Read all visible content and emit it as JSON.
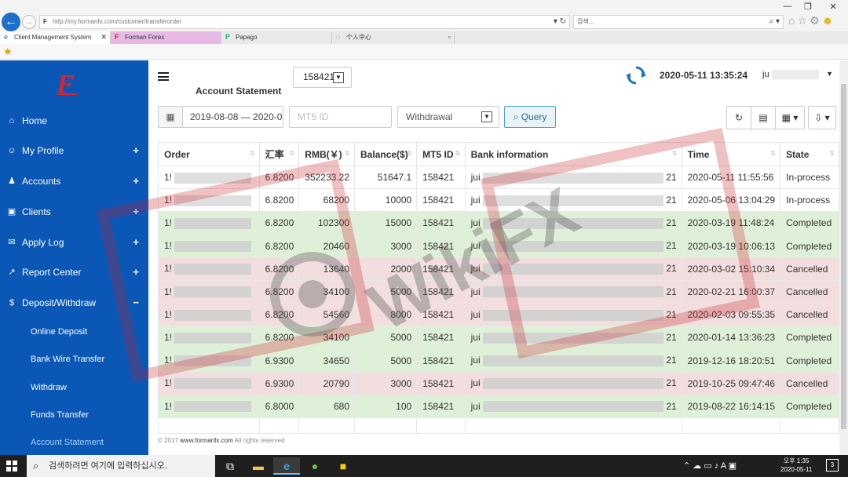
{
  "browser": {
    "url": "http://my.formanfx.com/customer/transferorder",
    "search_placeholder": "검색...",
    "tabs": [
      {
        "label": "Client Management System",
        "icon": "e"
      },
      {
        "label": "Forman Forex",
        "icon": "F"
      },
      {
        "label": "Papago",
        "icon": "P"
      },
      {
        "label": "个人中心",
        "icon": "◌"
      }
    ]
  },
  "sidebar": {
    "logo_letter": "F",
    "items": [
      {
        "label": "Home",
        "icon": "home-icon",
        "glyph": "⌂",
        "expand": ""
      },
      {
        "label": "My Profile",
        "icon": "user-icon",
        "glyph": "☺",
        "expand": "+"
      },
      {
        "label": "Accounts",
        "icon": "users-icon",
        "glyph": "♟",
        "expand": "+"
      },
      {
        "label": "Clients",
        "icon": "id-card-icon",
        "glyph": "▣",
        "expand": "+"
      },
      {
        "label": "Apply Log",
        "icon": "inbox-icon",
        "glyph": "✉",
        "expand": "+"
      },
      {
        "label": "Report Center",
        "icon": "chart-icon",
        "glyph": "↗",
        "expand": "+"
      },
      {
        "label": "Deposit/Withdraw",
        "icon": "dollar-icon",
        "glyph": "$",
        "expand": "−"
      }
    ],
    "sub_items": [
      {
        "label": "Online Deposit"
      },
      {
        "label": "Bank Wire Transfer"
      },
      {
        "label": "Withdraw"
      },
      {
        "label": "Funds Transfer"
      },
      {
        "label": "Account Statement"
      }
    ]
  },
  "header": {
    "page_title": "Account Statement",
    "account": "158421",
    "datetime": "2020-05-11 13:35:24",
    "user_initial": "ju"
  },
  "filters": {
    "date_range": "2019-08-08 — 2020-05",
    "mt5_placeholder": "MT5 ID",
    "type": "Withdrawal",
    "query_label": "Query"
  },
  "table": {
    "columns": [
      "Order",
      "汇率",
      "RMB(￥)",
      "Balance($)",
      "MT5 ID",
      "Bank information",
      "Time",
      "State"
    ],
    "rows": [
      {
        "order": "1!",
        "rate": "6.8200",
        "rmb": "352233.22",
        "balance": "51647.1",
        "mt5": "158421",
        "bank": "jui",
        "bank_end": "21",
        "time": "2020-05-11 11:55:56",
        "state": "In-process"
      },
      {
        "order": "1!",
        "rate": "6.8200",
        "rmb": "68200",
        "balance": "10000",
        "mt5": "158421",
        "bank": "jui",
        "bank_end": "21",
        "time": "2020-05-06 13:04:29",
        "state": "In-process"
      },
      {
        "order": "1!",
        "rate": "6.8200",
        "rmb": "102300",
        "balance": "15000",
        "mt5": "158421",
        "bank": "jui",
        "bank_end": "21",
        "time": "2020-03-19 11:48:24",
        "state": "Completed"
      },
      {
        "order": "1!",
        "rate": "6.8200",
        "rmb": "20460",
        "balance": "3000",
        "mt5": "158421",
        "bank": "jui",
        "bank_end": "21",
        "time": "2020-03-19 10:06:13",
        "state": "Completed"
      },
      {
        "order": "1!",
        "rate": "6.8200",
        "rmb": "13640",
        "balance": "2000",
        "mt5": "158421",
        "bank": "jui",
        "bank_end": "21",
        "time": "2020-03-02 15:10:34",
        "state": "Cancelled"
      },
      {
        "order": "1!",
        "rate": "6.8200",
        "rmb": "34100",
        "balance": "5000",
        "mt5": "158421",
        "bank": "jui",
        "bank_end": "21",
        "time": "2020-02-21 16:00:37",
        "state": "Cancelled"
      },
      {
        "order": "1!",
        "rate": "6.8200",
        "rmb": "54560",
        "balance": "8000",
        "mt5": "158421",
        "bank": "jui",
        "bank_end": "21",
        "time": "2020-02-03 09:55:35",
        "state": "Cancelled"
      },
      {
        "order": "1!",
        "rate": "6.8200",
        "rmb": "34100",
        "balance": "5000",
        "mt5": "158421",
        "bank": "jui",
        "bank_end": "21",
        "time": "2020-01-14 13:36:23",
        "state": "Completed"
      },
      {
        "order": "1!",
        "rate": "6.9300",
        "rmb": "34650",
        "balance": "5000",
        "mt5": "158421",
        "bank": "jui",
        "bank_end": "21",
        "time": "2019-12-16 18:20:51",
        "state": "Completed"
      },
      {
        "order": "1!",
        "rate": "6.9300",
        "rmb": "20790",
        "balance": "3000",
        "mt5": "158421",
        "bank": "jui",
        "bank_end": "21",
        "time": "2019-10-25 09:47:46",
        "state": "Cancelled"
      },
      {
        "order": "1!",
        "rate": "6.8000",
        "rmb": "680",
        "balance": "100",
        "mt5": "158421",
        "bank": "jui",
        "bank_end": "21",
        "time": "2019-08-22 16:14:15",
        "state": "Completed"
      }
    ]
  },
  "footer": {
    "copyright_prefix": "© 2017",
    "site": "www.formanfx.com",
    "rights": "All rights reserved"
  },
  "watermark": {
    "text": "WikiFX"
  },
  "taskbar": {
    "search_placeholder": "검색하려면 여기에 입력하십시오.",
    "clock_ampm": "오후 1:35",
    "clock_date": "2020-05-11",
    "notify_count": "3"
  },
  "colors": {
    "sidebar": "#0b57b6",
    "completed_row": "#dff0d8",
    "cancelled_row": "#f2dede",
    "logo_red": "#d8262e"
  }
}
